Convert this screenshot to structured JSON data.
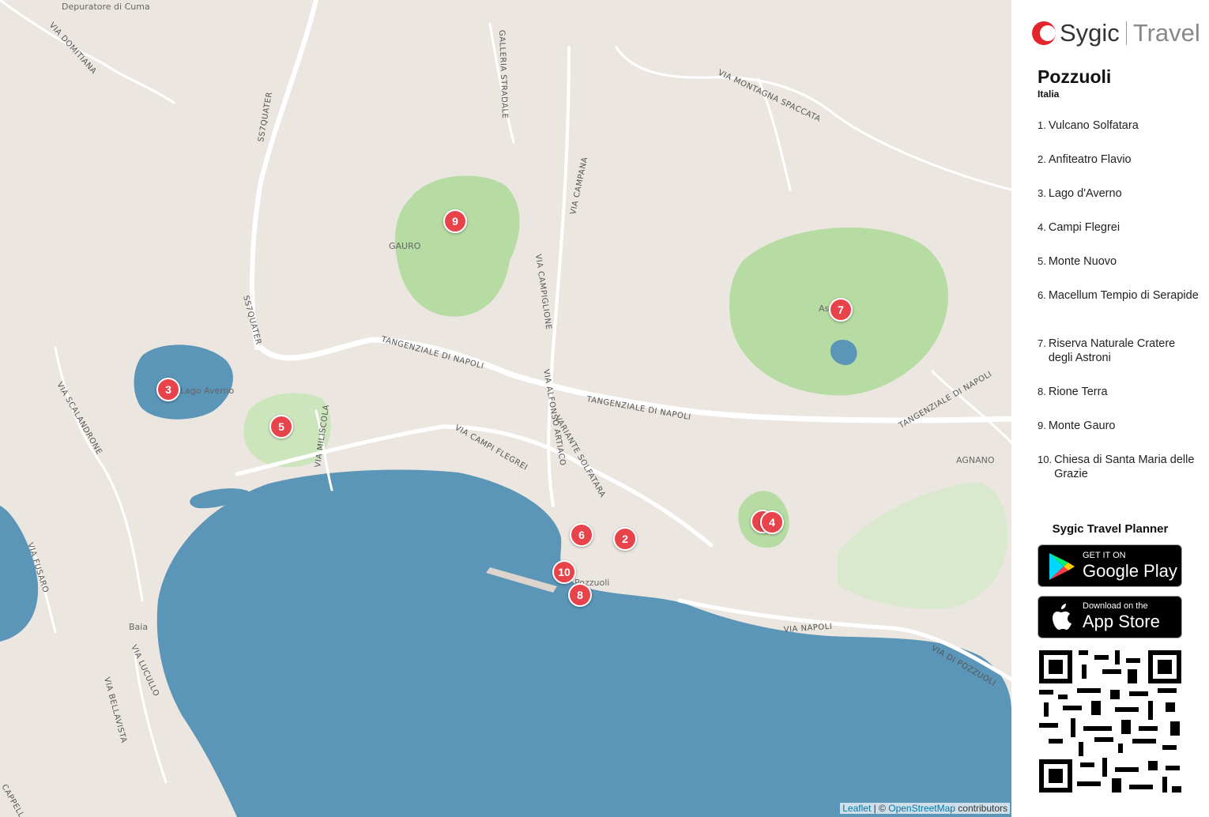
{
  "map": {
    "attribution_leaflet": "Leaflet",
    "attribution_sep": " | © ",
    "attribution_osm": "OpenStreetMap",
    "attribution_tail": " contributors",
    "road_labels": [
      "VIA DOMITIANA",
      "SS7QUATER",
      "SS7QUATER",
      "GALLERIA STRADALE",
      "VIA MONTAGNA SPACCATA",
      "VIA CAMPANA",
      "VIA CAMPIGLIONE",
      "TANGENZIALE DI NAPOLI",
      "TANGENZIALE DI NAPOLI",
      "TANGENZIALE DI NAPOLI",
      "VIA SCALANDRONE",
      "VIA MILISCOLA",
      "VIA CAMPI FLEGREI",
      "VIA ALFONSO ARTIACO",
      "VARIANTE SOLFATARA",
      "VIA FUSARO",
      "VIA LUCULLO",
      "VIA BELLAVISTA",
      "VIA NAPOLI",
      "VIA DI POZZUOLI",
      "CAPPELLA"
    ],
    "place_labels": [
      "Depuratore di Cuma",
      "GAURO",
      "AGNANO",
      "Baia",
      "Pozzuoli",
      "Lago Averno",
      "Astroni"
    ],
    "markers": [
      "9",
      "7",
      "3",
      "5",
      "6",
      "2",
      "10",
      "8",
      "1",
      "4"
    ],
    "colors": {
      "land": "#ece6e1",
      "water": "#5b95b8",
      "park": "#b6dba3",
      "marker": "#e8434b",
      "road": "#ffffff"
    }
  },
  "sidebar": {
    "logo_sygic": "Sygic",
    "logo_travel": "Travel",
    "logo_icon": "sygic-logo-icon",
    "city": "Pozzuoli",
    "country": "Italia",
    "pois": [
      {
        "num": "1.",
        "name": "Vulcano Solfatara"
      },
      {
        "num": "2.",
        "name": "Anfiteatro Flavio"
      },
      {
        "num": "3.",
        "name": "Lago d'Averno"
      },
      {
        "num": "4.",
        "name": "Campi Flegrei"
      },
      {
        "num": "5.",
        "name": "Monte Nuovo"
      },
      {
        "num": "6.",
        "name": "Macellum Tempio di Serapide"
      },
      {
        "num": "7.",
        "name": "Riserva Naturale Cratere degli Astroni"
      },
      {
        "num": "8.",
        "name": "Rione Terra"
      },
      {
        "num": "9.",
        "name": "Monte Gauro"
      },
      {
        "num": "10.",
        "name": "Chiesa di Santa Maria delle Grazie"
      }
    ],
    "planner_title": "Sygic Travel Planner",
    "google_small": "GET IT ON",
    "google_big": "Google Play",
    "apple_small": "Download on the",
    "apple_big": "App Store",
    "qr_icon": "qr-code-icon"
  }
}
